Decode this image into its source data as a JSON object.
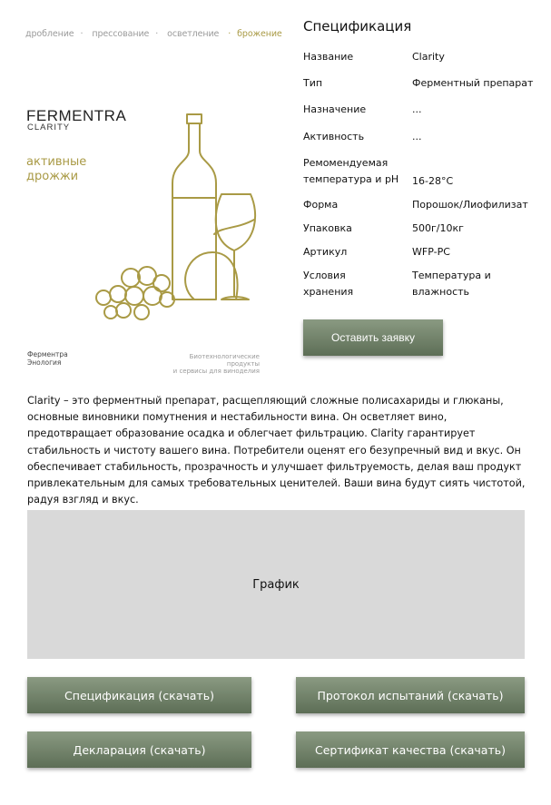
{
  "product_card": {
    "process_steps": [
      "дробление",
      "прессование",
      "осветление",
      "брожение"
    ],
    "active_step_color": "#a99a45",
    "brand": "FERMENTRA",
    "subbrand": "CLARITY",
    "yeast_line1": "активные",
    "yeast_line2": "дрожжи",
    "logo_line1": "Ферментра",
    "logo_line2": "Энология",
    "tagline_line1": "Биотехнологические продукты",
    "tagline_line2": "и сервисы для виноделия"
  },
  "spec": {
    "title": "Спецификация",
    "rows": [
      {
        "label": "Название",
        "value": "Clarity"
      },
      {
        "label": "Тип",
        "value": "Ферментный препарат"
      },
      {
        "label": "Назначение",
        "value": "..."
      },
      {
        "label": "Активность",
        "value": "..."
      },
      {
        "label": "Ремомендуемая температура и pH",
        "value": "16-28°C"
      },
      {
        "label": "Форма",
        "value": "Порошок/Лиофилизат"
      },
      {
        "label": "Упаковка",
        "value": "500г/10кг"
      },
      {
        "label": "Артикул",
        "value": "WFP-PC"
      },
      {
        "label": "Условия хранения",
        "value": "Температура и влажность"
      }
    ],
    "cta_label": "Оставить заявку"
  },
  "description": "Clarity – это ферментный препарат, расщепляющий сложные полисахариды и глюканы, основные виновники помутнения и нестабильности вина. Он осветляет вино, предотвращает образование осадка и облегчает фильтрацию. Clarity гарантирует стабильность и чистоту вашего вина. Потребители оценят его безупречный вид и вкус. Он обеспечивает стабильность, прозрачность и улучшает фильтруемость, делая ваш продукт привлекательным для самых требовательных ценителей. Ваши вина будут сиять чистотой, радуя взгляд и вкус.",
  "graph_label": "График",
  "downloads": {
    "spec": "Спецификация (скачать)",
    "protocol": "Протокол испытаний (скачать)",
    "declaration": "Декларация (скачать)",
    "certificate": "Сертификат качества (скачать)"
  },
  "colors": {
    "accent_olive": "#a99a45",
    "button_green": "#6f8068",
    "placeholder_gray": "#d9d9d9"
  },
  "icons": [
    "wine-bottle-icon",
    "wine-glass-icon",
    "grapes-icon"
  ]
}
